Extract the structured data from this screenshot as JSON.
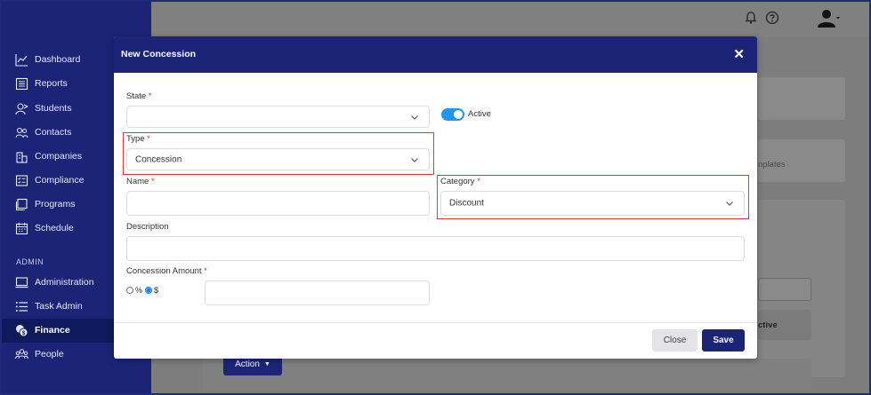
{
  "sidebar": {
    "items": [
      {
        "label": "Dashboard",
        "icon": "chart-line-icon"
      },
      {
        "label": "Reports",
        "icon": "report-icon"
      },
      {
        "label": "Students",
        "icon": "students-icon"
      },
      {
        "label": "Contacts",
        "icon": "contacts-icon"
      },
      {
        "label": "Companies",
        "icon": "companies-icon"
      },
      {
        "label": "Compliance",
        "icon": "compliance-icon"
      },
      {
        "label": "Programs",
        "icon": "programs-icon"
      },
      {
        "label": "Schedule",
        "icon": "calendar-icon"
      }
    ],
    "section_admin": "ADMIN",
    "admin_items": [
      {
        "label": "Administration",
        "icon": "monitor-icon"
      },
      {
        "label": "Task Admin",
        "icon": "list-icon"
      },
      {
        "label": "Finance",
        "icon": "finance-icon"
      },
      {
        "label": "People",
        "icon": "people-icon"
      }
    ]
  },
  "background": {
    "tab_fragment": "nplates",
    "column_fragment": "ctive",
    "action_label": "Action"
  },
  "modal": {
    "title": "New Concession",
    "close": "✕",
    "state": {
      "label": "State",
      "value": ""
    },
    "active_label": "Active",
    "active_on": true,
    "type": {
      "label": "Type",
      "value": "Concession"
    },
    "name": {
      "label": "Name",
      "value": ""
    },
    "category": {
      "label": "Category",
      "value": "Discount"
    },
    "description": {
      "label": "Description",
      "value": ""
    },
    "amount": {
      "label": "Concession Amount",
      "value": "",
      "opt_percent": "%",
      "opt_dollar": "$",
      "selected": "$"
    },
    "required_mark": "*",
    "buttons": {
      "close": "Close",
      "save": "Save"
    }
  },
  "colors": {
    "brand": "#1c2478",
    "toggle": "#2196f3",
    "highlight": "#e53935"
  }
}
